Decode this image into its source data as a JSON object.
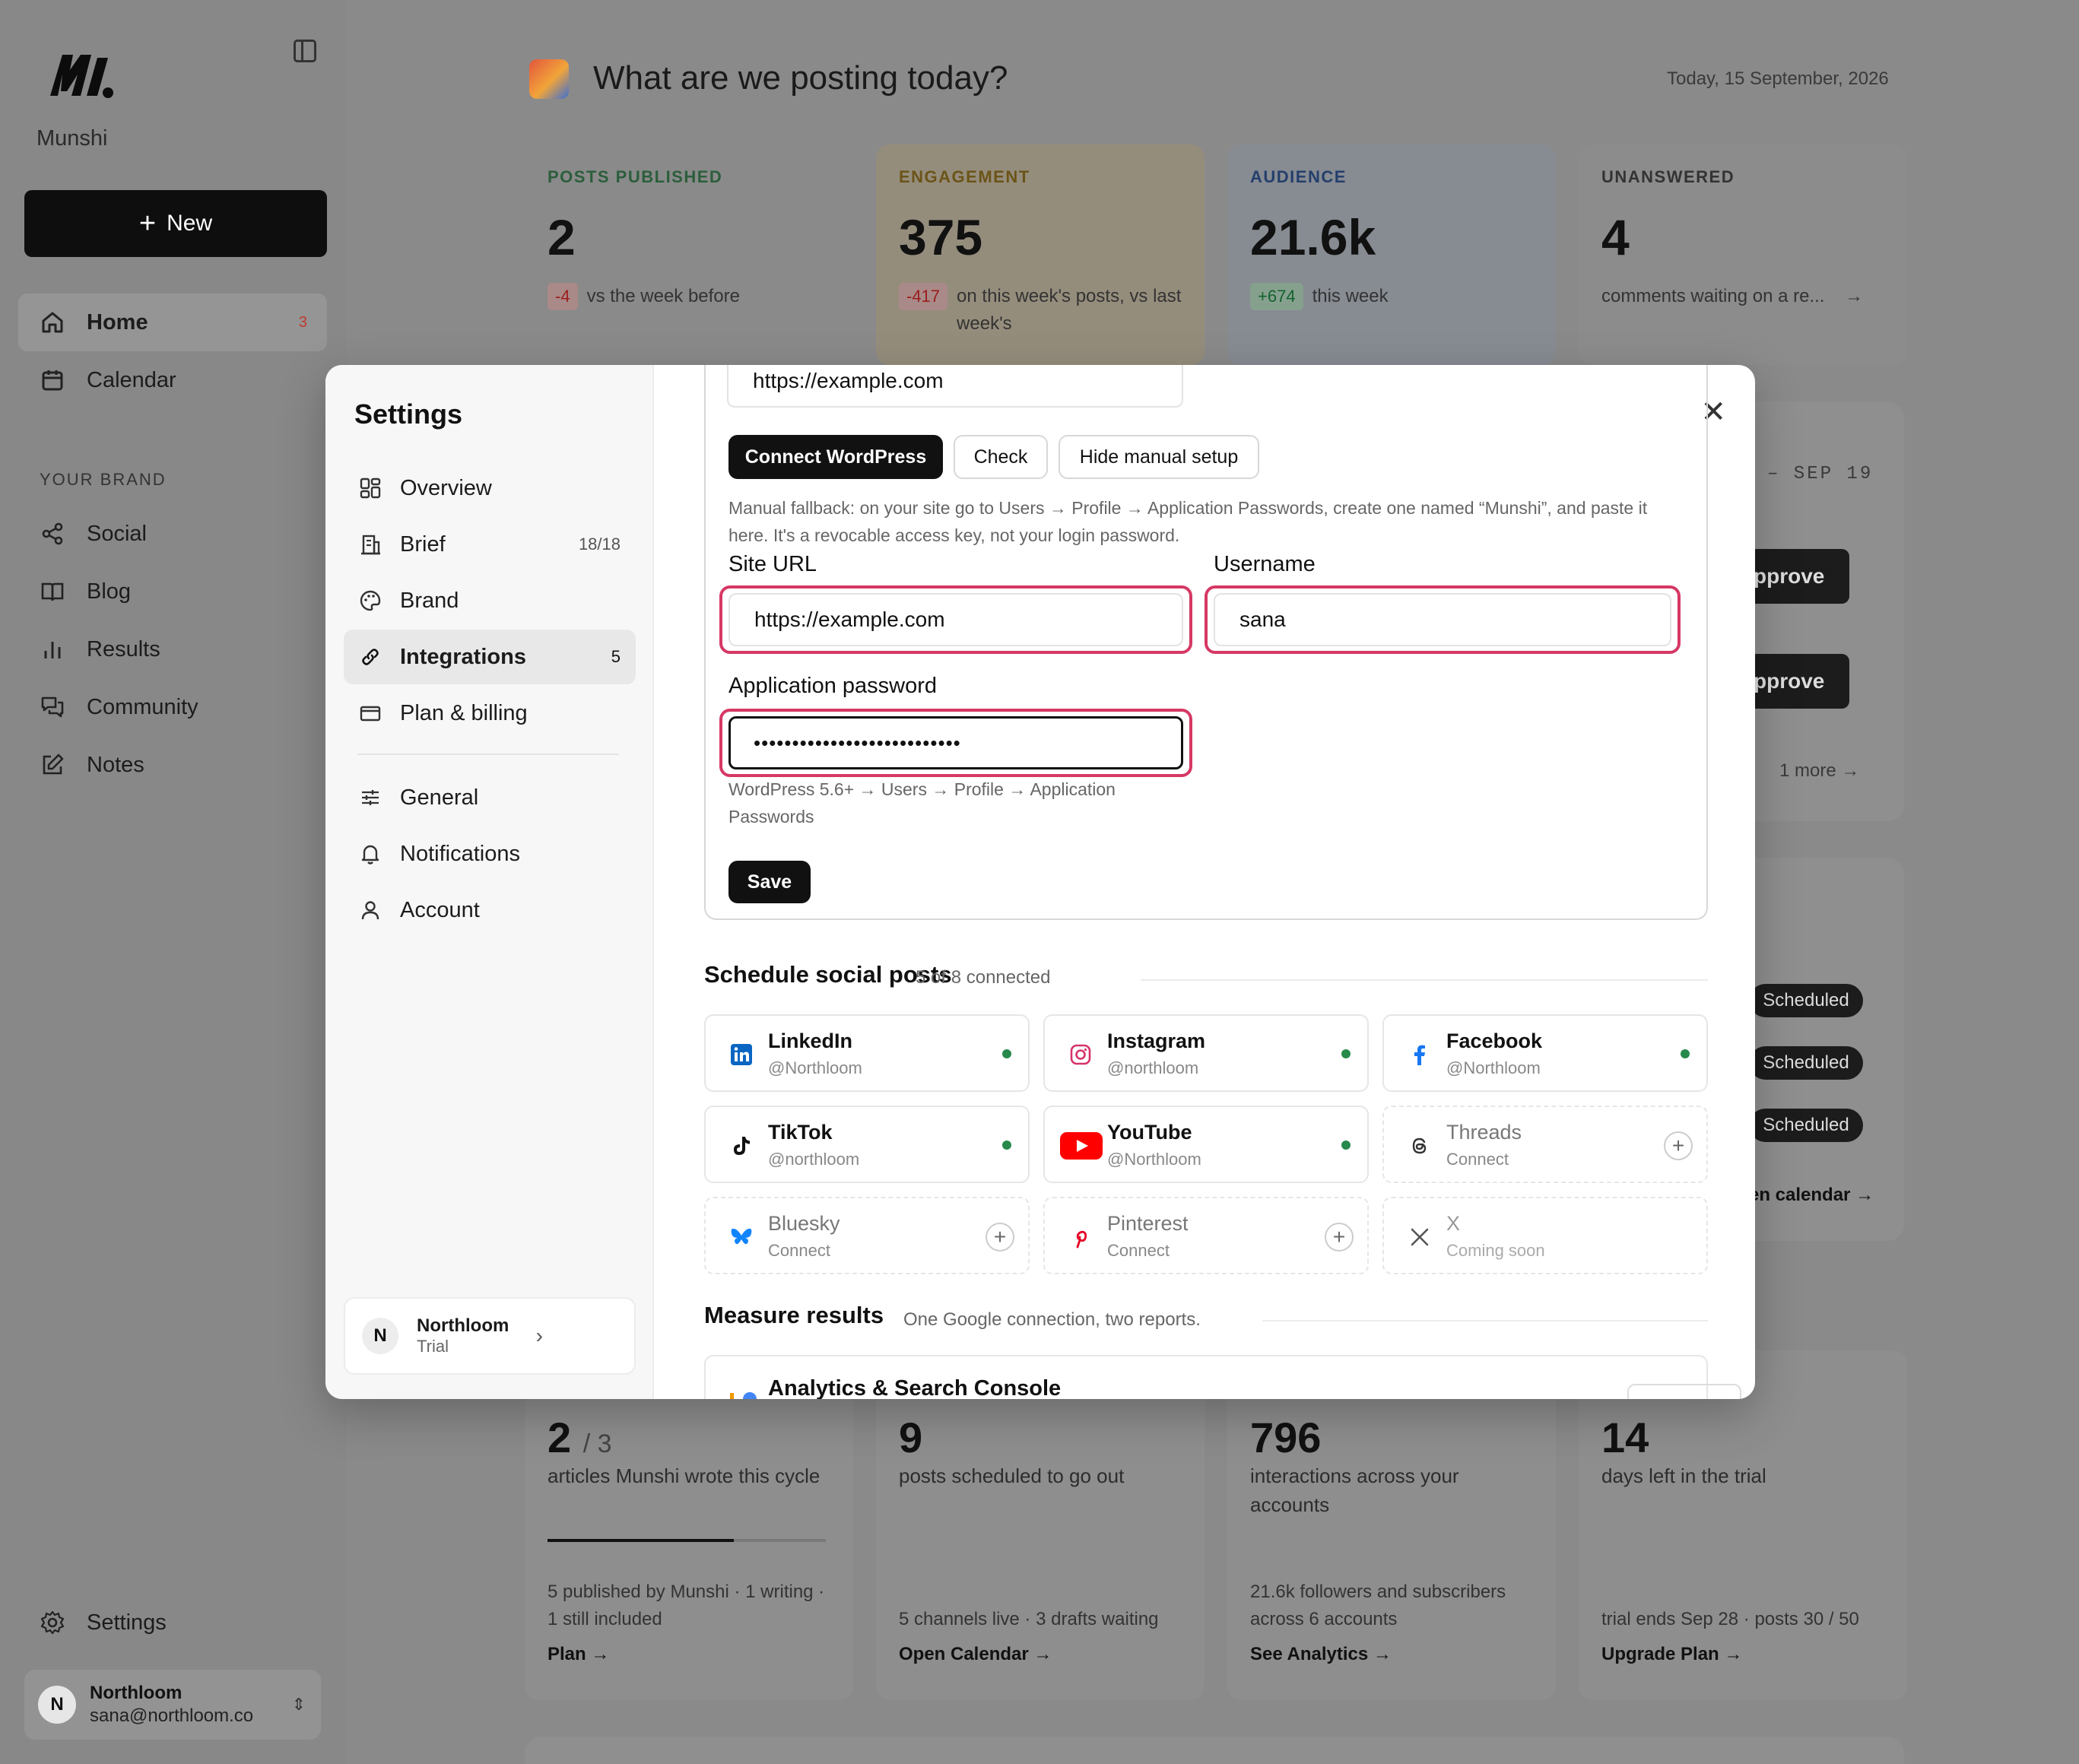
{
  "app": {
    "name": "Munshi"
  },
  "sidebar": {
    "new_label": "New",
    "nav": [
      {
        "label": "Home",
        "badge": "3"
      },
      {
        "label": "Calendar"
      }
    ],
    "section_label": "YOUR BRAND",
    "brand_nav": [
      {
        "label": "Social"
      },
      {
        "label": "Blog"
      },
      {
        "label": "Results"
      },
      {
        "label": "Community"
      },
      {
        "label": "Notes"
      }
    ],
    "settings_label": "Settings",
    "user": {
      "name": "Northloom",
      "email": "sana@northloom.co",
      "initial": "N"
    }
  },
  "main": {
    "title": "What are we posting today?",
    "date": "Today, 15 September, 2026",
    "stats": [
      {
        "label": "POSTS PUBLISHED",
        "value": "2",
        "delta": "-4",
        "note": "vs the week before"
      },
      {
        "label": "ENGAGEMENT",
        "value": "375",
        "delta": "-417",
        "note": "on this week's posts, vs last week's"
      },
      {
        "label": "AUDIENCE",
        "value": "21.6k",
        "delta": "+674",
        "note": "this week"
      },
      {
        "label": "UNANSWERED",
        "value": "4",
        "note": "comments waiting on a re..."
      }
    ],
    "week_range": "– SEP 19",
    "approve_label": "pprove",
    "more_label": "1 more",
    "scheduled_label": "Scheduled",
    "calendar_link": "en calendar →",
    "bottom_cards": [
      {
        "value": "2",
        "value_suffix": "/ 3",
        "desc": "articles Munshi wrote this cycle",
        "progress": 0.67,
        "foot": "5 published by Munshi · 1 writing · 1 still included",
        "link": "Plan →"
      },
      {
        "value": "9",
        "desc": "posts scheduled to go out",
        "foot": "5 channels live · 3 drafts waiting",
        "link": "Open Calendar →"
      },
      {
        "value": "796",
        "desc": "interactions across your accounts",
        "foot": "21.6k followers and subscribers across 6 accounts",
        "link": "See Analytics →"
      },
      {
        "value": "14",
        "desc": "days left in the trial",
        "foot": "trial ends Sep 28 · posts 30 / 50",
        "link": "Upgrade Plan →"
      }
    ]
  },
  "settings": {
    "title": "Settings",
    "nav": [
      {
        "label": "Overview"
      },
      {
        "label": "Brief",
        "count": "18/18"
      },
      {
        "label": "Brand"
      },
      {
        "label": "Integrations",
        "count": "5"
      },
      {
        "label": "Plan & billing"
      },
      {
        "label": "General"
      },
      {
        "label": "Notifications"
      },
      {
        "label": "Account"
      }
    ],
    "workspace": {
      "name": "Northloom",
      "plan": "Trial",
      "initial": "N"
    },
    "wordpress": {
      "top_url_value": "https://example.com",
      "connect_label": "Connect WordPress",
      "check_label": "Check",
      "hide_label": "Hide manual setup",
      "fallback_help": "Manual fallback: on your site go to Users → Profile → Application Passwords, create one named “Munshi”, and paste it here. It's a revocable access key, not your login password.",
      "site_url_label": "Site URL",
      "site_url_value": "https://example.com",
      "username_label": "Username",
      "username_value": "sana",
      "password_label": "Application password",
      "password_value": "•••••••••••••••••••••••••••",
      "password_help": "WordPress 5.6+ → Users → Profile → Application Passwords",
      "save_label": "Save"
    },
    "social": {
      "title": "Schedule social posts",
      "subtitle": "5 of 8 connected",
      "items": [
        {
          "name": "LinkedIn",
          "handle": "@Northloom",
          "status": "connected",
          "icon": "linkedin-icon",
          "color": "#0a66c2"
        },
        {
          "name": "Instagram",
          "handle": "@northloom",
          "status": "connected",
          "icon": "instagram-icon",
          "color": "#d6336c"
        },
        {
          "name": "Facebook",
          "handle": "@Northloom",
          "status": "connected",
          "icon": "facebook-icon",
          "color": "#1877f2"
        },
        {
          "name": "TikTok",
          "handle": "@northloom",
          "status": "connected",
          "icon": "tiktok-icon",
          "color": "#111111"
        },
        {
          "name": "YouTube",
          "handle": "@Northloom",
          "status": "connected",
          "icon": "youtube-icon",
          "color": "#ff0000"
        },
        {
          "name": "Threads",
          "handle": "Connect",
          "status": "available",
          "icon": "threads-icon",
          "color": "#333333"
        },
        {
          "name": "Bluesky",
          "handle": "Connect",
          "status": "available",
          "icon": "bluesky-icon",
          "color": "#1185fe"
        },
        {
          "name": "Pinterest",
          "handle": "Connect",
          "status": "available",
          "icon": "pinterest-icon",
          "color": "#e60023"
        },
        {
          "name": "X",
          "handle": "Coming soon",
          "status": "soon",
          "icon": "x-icon",
          "color": "#555555"
        }
      ]
    },
    "measure": {
      "title": "Measure results",
      "subtitle": "One Google connection, two reports.",
      "card_title": "Analytics & Search Console"
    }
  }
}
